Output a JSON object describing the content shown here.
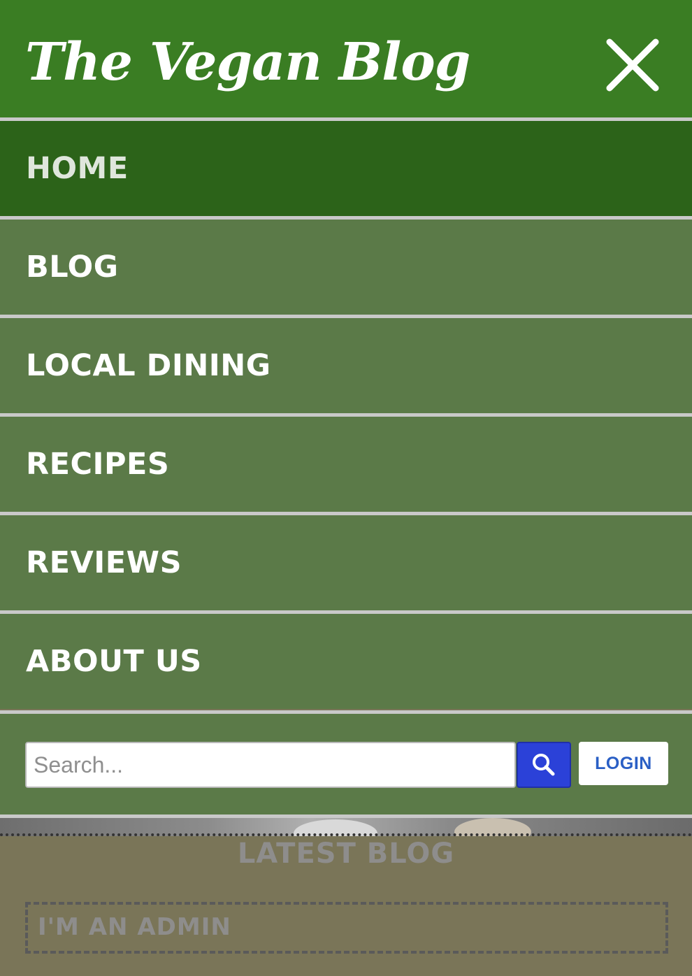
{
  "header": {
    "logo_text": "The Vegan Blog",
    "close_icon": "close-icon"
  },
  "nav": {
    "items": [
      {
        "label": "HOME",
        "active": true
      },
      {
        "label": "BLOG",
        "active": false
      },
      {
        "label": "LOCAL DINING",
        "active": false
      },
      {
        "label": "RECIPES",
        "active": false
      },
      {
        "label": "REVIEWS",
        "active": false
      },
      {
        "label": "ABOUT US",
        "active": false
      }
    ]
  },
  "search": {
    "placeholder": "Search...",
    "value": "",
    "button_icon": "search-icon",
    "login_label": "LOGIN"
  },
  "content": {
    "section_title": "LATEST BLOG",
    "admin_label": "I'M AN ADMIN"
  },
  "colors": {
    "header_green": "#3a7d23",
    "active_nav": "#2c6319",
    "nav_bg": "#5b7a48",
    "search_button": "#2b41d8",
    "login_text": "#2a5fc5"
  }
}
